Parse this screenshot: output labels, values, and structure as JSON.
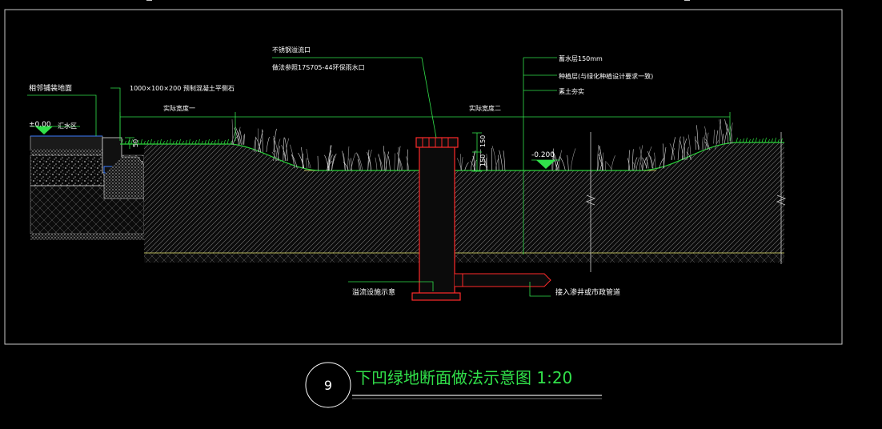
{
  "labels": {
    "adjacent_paving": "相邻铺装地面",
    "curb_spec": "1000×100×200  预制混凝土平侧石",
    "elev_left": "±0.00",
    "catchment": "汇水区",
    "width_one": "实际宽度一",
    "width_two": "实际宽度二",
    "overflow_mouth": "不锈钢溢流口",
    "overflow_ref": "做法参照17S705-44环保雨水口",
    "layer_storage": "蓄水层150mm",
    "layer_planting": "种植层(与绿化种植设计要求一致)",
    "layer_soil": "素土夯实",
    "dim_a": "150",
    "dim_b": "150",
    "dim_c": "50",
    "elev_right": "-0.200",
    "overflow_facility": "溢流设施示意",
    "connect_pipe": "接入渗井或市政管道"
  },
  "title_block": {
    "number": "9",
    "title": "下凹绿地断面做法示意图 1:20"
  },
  "colors": {
    "background": "#000000",
    "frame": "#c8c8c8",
    "soil_hatch": "#8a8a8a",
    "grass": "#2ad13a",
    "leader": "#31e04a",
    "pipe": "#ff2a2a",
    "marker": "#31e04a",
    "yellow_line": "#e8e870"
  }
}
